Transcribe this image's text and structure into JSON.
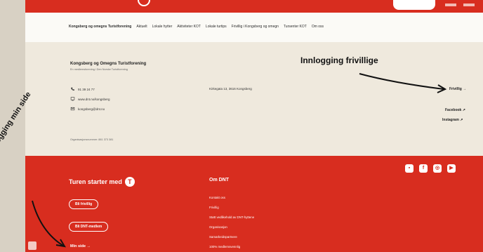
{
  "nav": {
    "items": [
      "Kongsberg og omegns Turistforening",
      "Aktuelt",
      "Lokale hytter",
      "Aktiviteter KOT",
      "Lokale turtips",
      "Frivillig i Kongsberg og omegn",
      "Tursenter KOT",
      "Om oss"
    ]
  },
  "footer": {
    "org_name": "Kongsberg og Omegns Turistforening",
    "org_sub": "En medlemsforening i Den Norske Turistforening",
    "phone": "91 39 24 77",
    "web": "www.dnt.no/kongsberg",
    "email": "kongsberg@dnt.no",
    "address": "Kirkegata 13, 3616 Kongsberg",
    "orgnr": "Organisasjonsnummer: 881 373 381",
    "frivillig_link": "Frivillig →",
    "facebook": "Facebook",
    "instagram": "Instagram"
  },
  "red": {
    "turen_title": "Turen starter med",
    "bli_frivillig": "Bli frivillig",
    "bli_medlem": "Bli DNT-medlem",
    "min_side": "Min side →",
    "om_dnt": "Om DNT",
    "links": [
      "Kontakt oss",
      "Frivillig",
      "Støtt vedlikehold av DNT-hyttene",
      "Organisasjon",
      "Samarbeidspartnere",
      "100% medlemsvennlig"
    ]
  },
  "annotations": {
    "innlogging_frivillige": "Innlogging frivillige",
    "innlogging_min_side": "Innlogging min side"
  },
  "colors": {
    "accent": "#d82d1f"
  }
}
